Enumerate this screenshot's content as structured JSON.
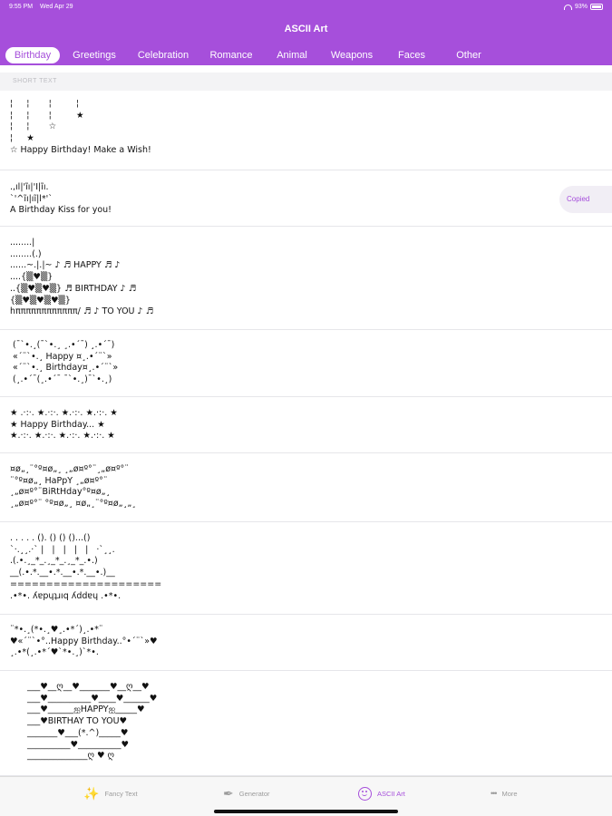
{
  "status_bar": {
    "time": "9:55 PM",
    "date": "Wed Apr 29",
    "battery": "93%"
  },
  "app_title": "ASCII Art",
  "tabs": [
    {
      "label": "Birthday",
      "active": true
    },
    {
      "label": "Greetings"
    },
    {
      "label": "Celebration"
    },
    {
      "label": "Romance"
    },
    {
      "label": "Animal"
    },
    {
      "label": "Weapons"
    },
    {
      "label": "Faces"
    },
    {
      "label": "Other"
    }
  ],
  "section_title": "SHORT TEXT",
  "copied_label": "Copied",
  "items": [
    {
      "text": "¦     ¦       ¦         ¦\n¦     ¦       ¦         ★\n¦     ¦       ☆\n¦     ★\n☆ Happy Birthday! Make a Wish!"
    },
    {
      "text": ".,ıl|'ĩı|'I|ĩı.\n`'^ĩı|ıĩ|l*'`\nA Birthday Kiss for you!"
    },
    {
      "text": "........|\n........(.)\n......~.|.|~ ♪ ♬ HAPPY ♬ ♪\n....{▒♥▒}\n..{▒♥▒♥▒} ♬ BIRTHDAY ♪ ♬\n{▒♥▒♥▒♥▒}\nhππππππππππππ/ ♬ ♪ TO YOU ♪ ♬"
    },
    {
      "text": " (¯`•.¸(¯`•.¸ ¸.•´¯) ¸.•´¯)\n «´¨`•.¸ Happy ¤¸.•´¨`»\n «´¨`•.¸ Birthday¤¸.•´¨`»\n (¸.•´¯(¸.•´¯ ¯`•.¸)¯`•.¸)"
    },
    {
      "text": "★ .·:·. ★.·:·. ★.·:·. ★.·:·. ★\n★ Happy Birthday... ★\n★.·:·. ★.·:·. ★.·:·. ★.·:·. ★"
    },
    {
      "text": "¤ø„¸¨°º¤ø„¸ ¸„ø¤º°¨¸„ø¤º°¨\n¨°º¤ø„¸ HaPpY ¸„ø¤º°¨\n¸„ø¤º°¨BiRtHday°º¤ø„¸\n¸„ø¤º°¨ °º¤ø„¸ ¤ø„¸¨°º¤ø„¸„¸"
    },
    {
      "text": ". . . . . (). () () ()...()\n`·.¸¸.·` |   |   |   |   |   ·`¸¸.\n.(.•.¸_*_.¸_*_.¸_*_.•.)\n__(.•.*.__•.*.__•.*.__•.)__\n=====================\n.•*•. ʎɐpɥʇɹıq ʎddɐɥ .•*•."
    },
    {
      "text": "¨*•.¸(*•.¸♥¸.•*´)¸.•*¨\n♥«´¨`•°..Happy Birthday..°•´¨`»♥\n¸.•*(¸.•*´♥`*•.¸)`*•."
    },
    {
      "text": "___♥__ღ__♥_______♥__ღ__♥\n___♥__________♥____♥______♥\n___♥______ஐHAPPYஐ_____♥\n___♥BIRTHAY TO YOU♥\n_______♥___(*.^)_____♥\n__________♥__________♥\n______________ღ ♥ ღ"
    }
  ],
  "bottom_bar": [
    {
      "label": "Fancy Text",
      "icon": "magic-wand-icon",
      "glyph": "✨"
    },
    {
      "label": "Generator",
      "icon": "feather-icon",
      "glyph": "✒"
    },
    {
      "label": "ASCII Art",
      "icon": "smile-icon",
      "active": true
    },
    {
      "label": "More",
      "icon": "more-icon",
      "glyph": "•••"
    }
  ],
  "colors": {
    "accent": "#a64fdb",
    "section_bg": "#f3f3f5"
  }
}
